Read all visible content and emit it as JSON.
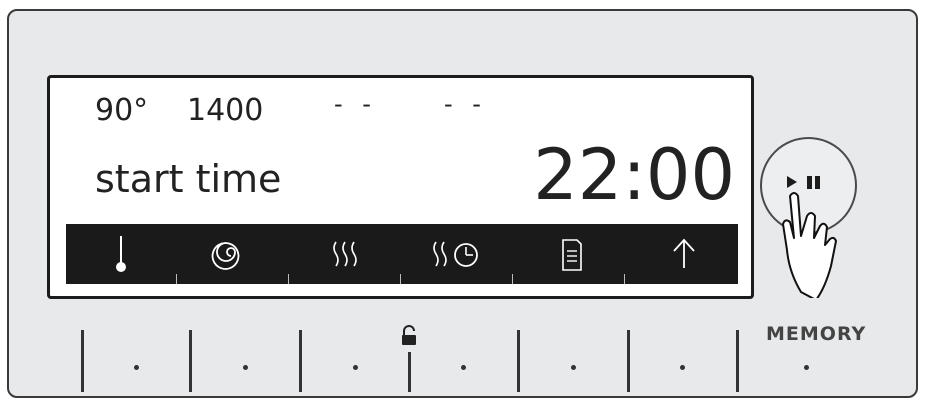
{
  "display": {
    "temperature": "90°",
    "spin": "1400",
    "option_3": "- -",
    "option_4": "- -",
    "mode_label": "start time",
    "clock": "22:00"
  },
  "icon_bar": [
    {
      "name": "temperature-icon"
    },
    {
      "name": "spin-icon"
    },
    {
      "name": "dry-icon"
    },
    {
      "name": "dry-time-icon"
    },
    {
      "name": "program-list-icon"
    },
    {
      "name": "up-arrow-icon"
    }
  ],
  "start_button": {
    "icon": "play-pause-icon"
  },
  "memory": {
    "label": "MEMORY"
  },
  "colors": {
    "panel": "#e8e9eb",
    "iconbar": "#1a1a1a",
    "text": "#222222"
  }
}
